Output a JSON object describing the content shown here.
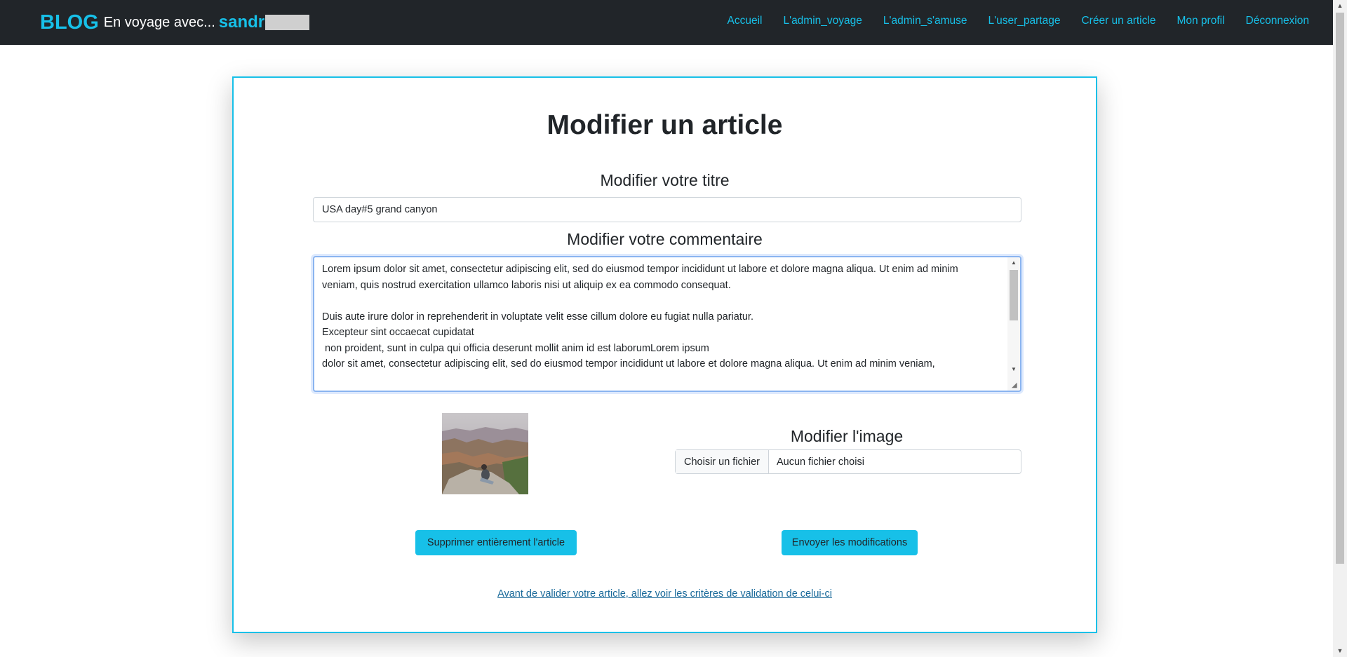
{
  "navbar": {
    "brand_blog": "BLOG",
    "brand_subtitle": "En voyage avec...",
    "brand_user": "sandr",
    "links": [
      "Accueil",
      "L'admin_voyage",
      "L'admin_s'amuse",
      "L'user_partage",
      "Créer un article",
      "Mon profil",
      "Déconnexion"
    ]
  },
  "page": {
    "title": "Modifier un article"
  },
  "form": {
    "title_label": "Modifier votre titre",
    "title_value": "USA day#5 grand canyon",
    "comment_label": "Modifier votre commentaire",
    "comment_value": "Lorem ipsum dolor sit amet, consectetur adipiscing elit, sed do eiusmod tempor incididunt ut labore et dolore magna aliqua. Ut enim ad minim veniam, quis nostrud exercitation ullamco laboris nisi ut aliquip ex ea commodo consequat.\n\nDuis aute irure dolor in reprehenderit in voluptate velit esse cillum dolore eu fugiat nulla pariatur.\nExcepteur sint occaecat cupidatat\n non proident, sunt in culpa qui officia deserunt mollit anim id est laborumLorem ipsum\ndolor sit amet, consectetur adipiscing elit, sed do eiusmod tempor incididunt ut labore et dolore magna aliqua. Ut enim ad minim veniam, ",
    "image_label": "Modifier l'image",
    "file_button": "Choisir un fichier",
    "file_status": "Aucun fichier choisi"
  },
  "actions": {
    "delete_label": "Supprimer entièrement l'article",
    "send_label": "Envoyer les modifications",
    "criteria_link": "Avant de valider votre article, allez voir les critères de validation de celui-ci"
  },
  "colors": {
    "navbar_bg": "#212529",
    "accent": "#17c0e8",
    "link": "#1a6a9a"
  }
}
